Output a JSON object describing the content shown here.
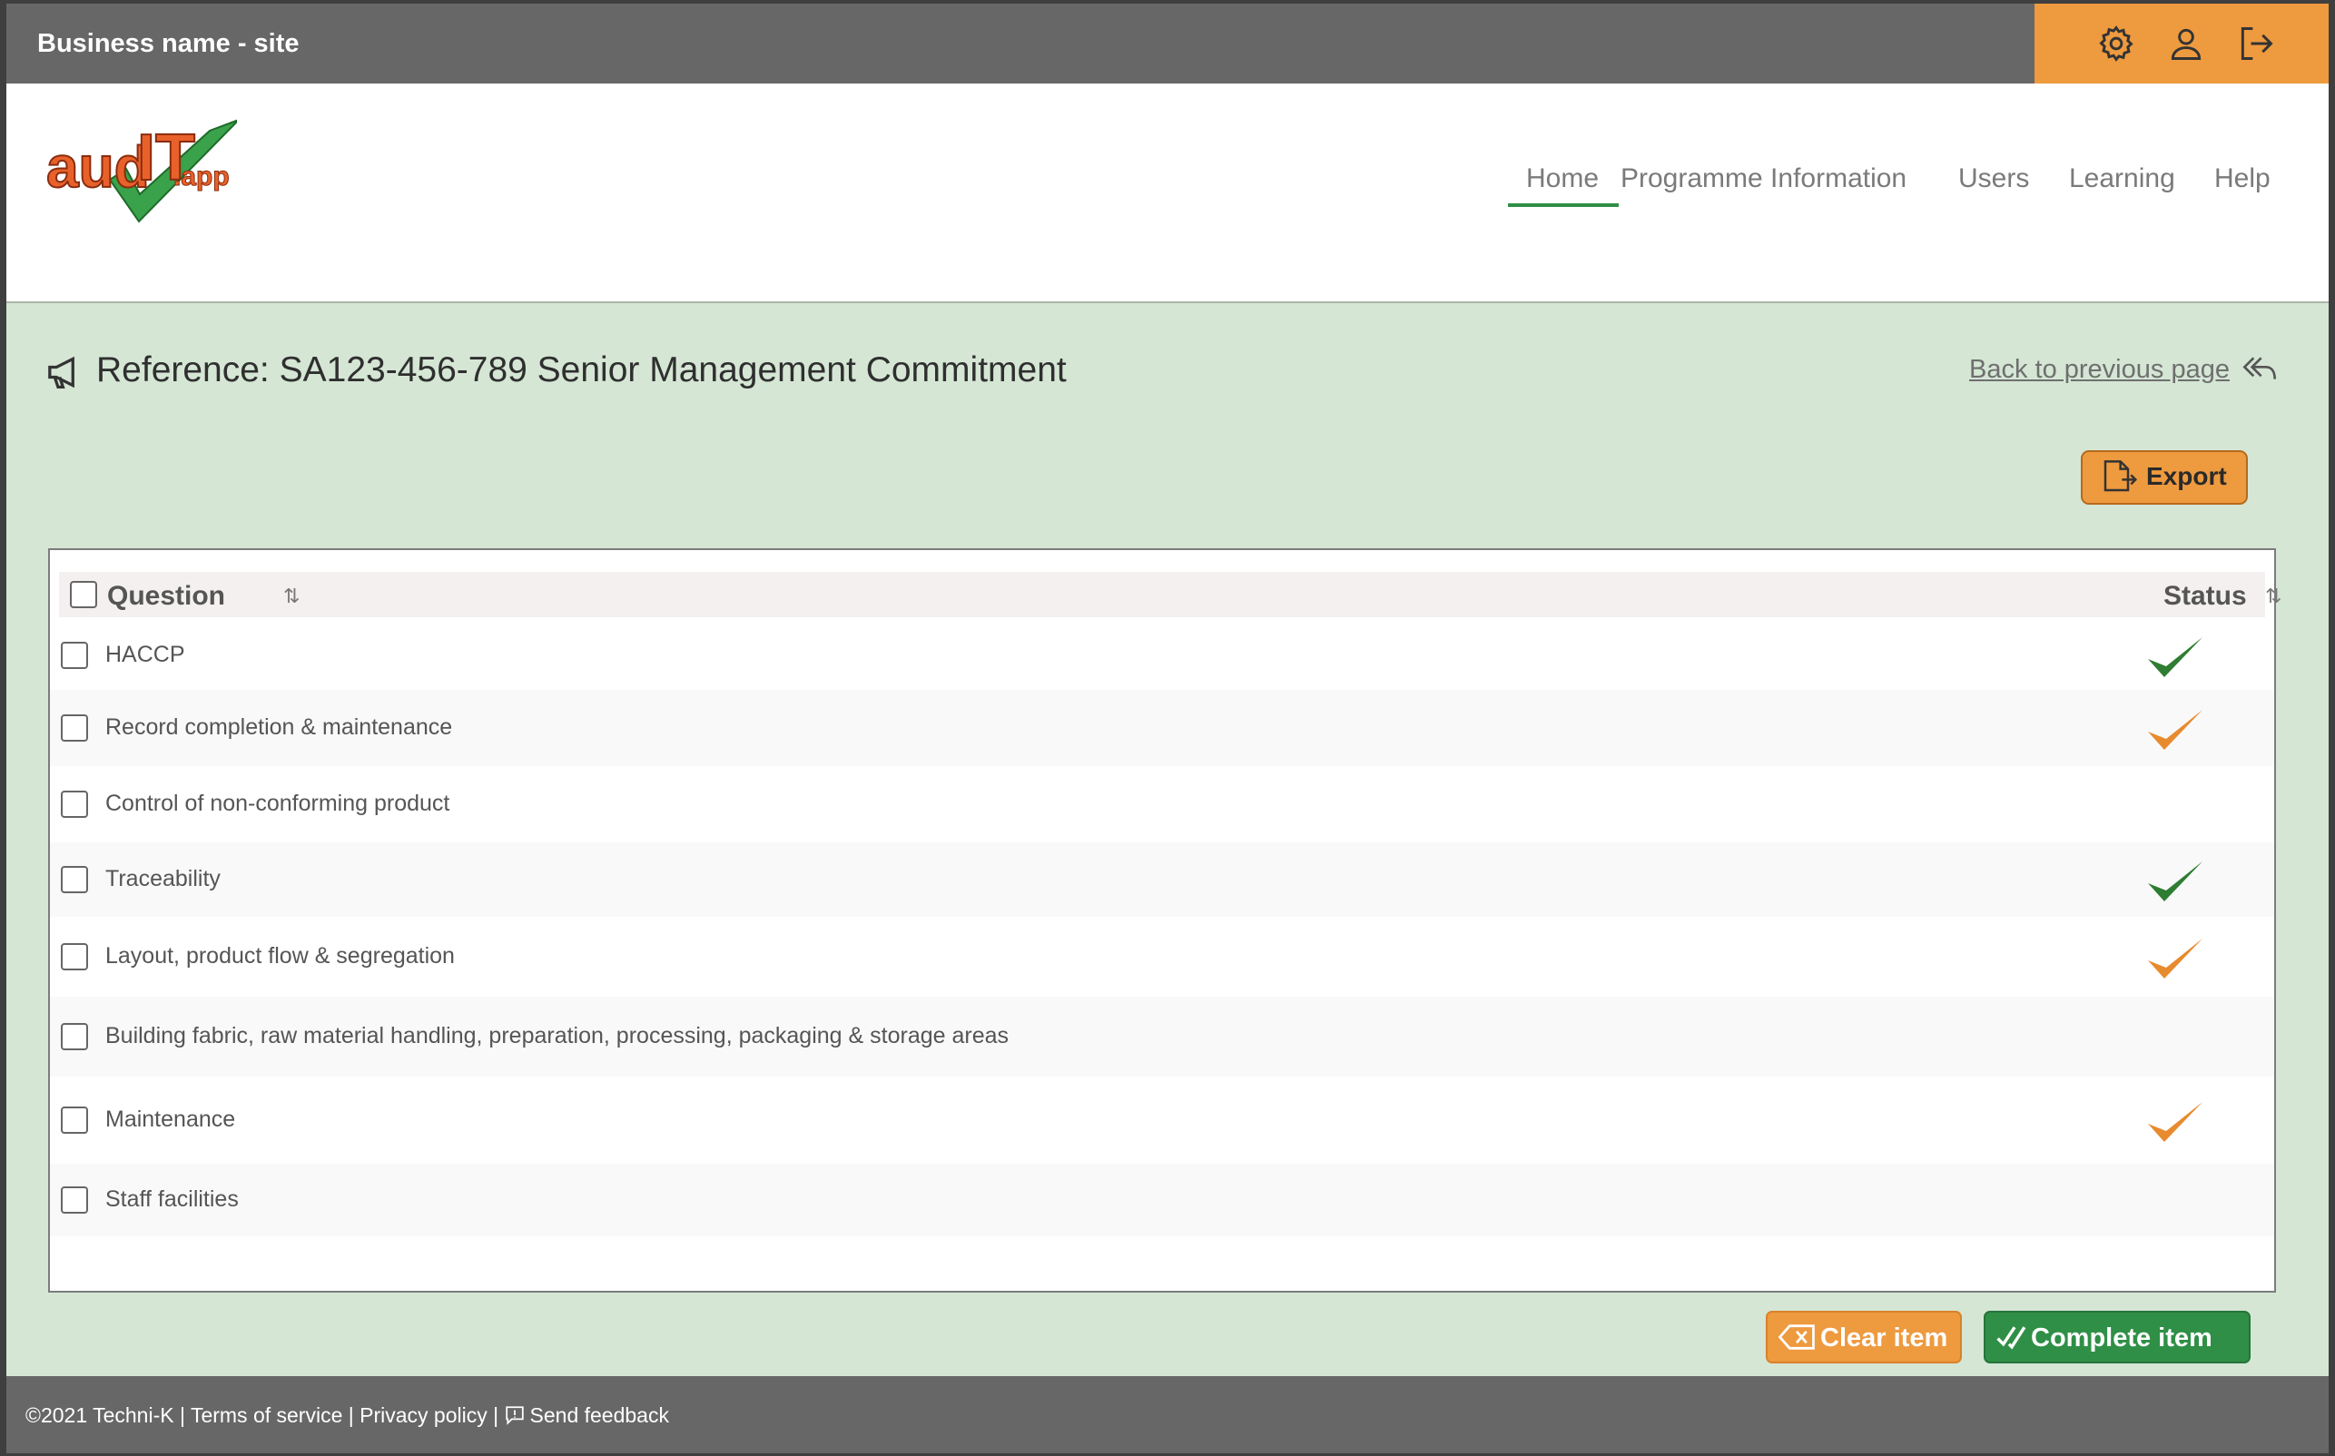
{
  "topbar": {
    "site_name": "Business name - site",
    "icons": [
      "gear-icon",
      "user-icon",
      "logout-icon"
    ],
    "accent": "#ee9a3f"
  },
  "nav": {
    "items": [
      "Home",
      "Programme Information",
      "Users",
      "Learning",
      "Help"
    ],
    "active": "Home"
  },
  "page": {
    "title": "Reference: SA123-456-789 Senior Management Commitment",
    "back_link": "Back to previous page",
    "export_label": "Export"
  },
  "table": {
    "columns": [
      "Question",
      "Status"
    ],
    "rows": [
      {
        "question": "HACCP",
        "status": "complete"
      },
      {
        "question": "Record completion & maintenance",
        "status": "in-progress"
      },
      {
        "question": "Control of non-conforming product",
        "status": ""
      },
      {
        "question": "Traceability",
        "status": "complete"
      },
      {
        "question": "Layout, product flow & segregation",
        "status": "in-progress"
      },
      {
        "question": "Building fabric, raw material handling, preparation, processing, packaging & storage areas",
        "status": ""
      },
      {
        "question": "Maintenance",
        "status": "in-progress"
      },
      {
        "question": "Staff facilities",
        "status": ""
      }
    ],
    "status_colors": {
      "complete": "#2f7d32",
      "in-progress": "#e88a2e"
    }
  },
  "actions": {
    "clear_label": "Clear item",
    "complete_label": "Complete item"
  },
  "footer": {
    "copyright": "©2021 Techni-K",
    "sep": "|",
    "terms": "Terms of service",
    "privacy": "Privacy policy",
    "feedback": "Send feedback"
  }
}
